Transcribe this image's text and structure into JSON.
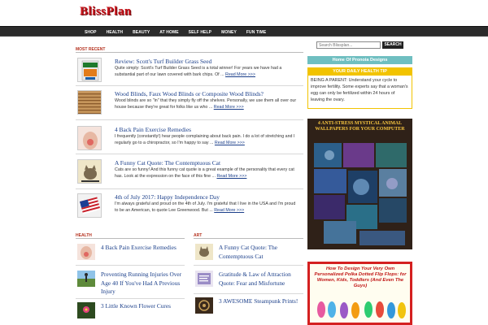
{
  "site": {
    "logo": "BlissPlan"
  },
  "nav": {
    "items": [
      "SHOP",
      "HEALTH",
      "BEAUTY",
      "AT HOME",
      "SELF HELP",
      "MONEY",
      "FUN TIME"
    ]
  },
  "most_recent": {
    "label": "MOST RECENT",
    "posts": [
      {
        "title": "Review: Scott's Turf Builder Grass Seed",
        "excerpt": "Quite simply: Scott's Turf Builder Grass Seed is a total winner! For years we have had a substantial part of our lawn covered with bark chips. Of ...",
        "read_more": "Read More >>>",
        "thumb_icon": "grass-seed-bag-icon"
      },
      {
        "title": "Wood Blinds, Faux Wood Blinds or Composite Wood Blinds?",
        "excerpt": "Wood blinds are so \"in\" that they simply fly off the shelves. Personally, we use them all over our house because they're great for folks like us who ...",
        "read_more": "Read More >>>",
        "thumb_icon": "wood-blinds-icon"
      },
      {
        "title": "4 Back Pain Exercise Remedies",
        "excerpt": "I frequently (constantly!) hear people complaining about back pain. I do a lot of stretching and I regularly go to a chiropractor, so I'm happy to say ...",
        "read_more": "Read More >>>",
        "thumb_icon": "back-pain-icon"
      },
      {
        "title": "A Funny Cat Quote: The Contemptuous Cat",
        "excerpt": "Cats are so funny! And this funny cat quote is a great example of the personality that every cat has. Look at the expression on the face of this fine ...",
        "read_more": "Read More >>>",
        "thumb_icon": "cat-icon"
      },
      {
        "title": "4th of July 2017: Happy Independence Day",
        "excerpt": "I'm always grateful and proud on the 4th of July. I'm grateful that I live in the USA and I'm proud to be an American, to quote Lee Greenwood. But ...",
        "read_more": "Read More >>>",
        "thumb_icon": "flag-icon"
      }
    ]
  },
  "health": {
    "label": "HEALTH",
    "posts": [
      {
        "title": "4 Back Pain Exercise Remedies",
        "thumb_icon": "back-pain-icon"
      },
      {
        "title": "Preventing Running Injuries Over Age 40 If You've Had A Previous Injury",
        "thumb_icon": "runner-icon"
      },
      {
        "title": "3 Little Known Flower Cures",
        "thumb_icon": "flower-icon"
      }
    ]
  },
  "art": {
    "label": "ART",
    "posts": [
      {
        "title": "A Funny Cat Quote: The Contemptuous Cat",
        "thumb_icon": "cat-icon"
      },
      {
        "title": "Gratitude & Law of Attraction Quote: Fear and Misfortune",
        "thumb_icon": "quote-card-icon"
      },
      {
        "title": "3 AWESOME Steampunk Prints!",
        "thumb_icon": "steampunk-icon"
      }
    ]
  },
  "sidebar": {
    "search_placeholder": "Search Blissplan...",
    "search_button": "SEARCH",
    "home_link": "Home Of Pronoia Designs",
    "health_tip": {
      "title": "YOUR DAILY HEALTH TIP",
      "text": "BEING A PARENT: Understand your cycle to improve fertility. Some experts say that a woman's egg can only be fertilized within 24 hours of leaving the ovary."
    },
    "ad1_title": "4 ANTI-STRESS MYSTICAL ANIMAL WALLPAPERS FOR YOUR COMPUTER",
    "ad2_title": "How To Design Your Very Own Personalized Polka Dotted Flip Flops: for Women, Kids, Toddlers (And Even The Guys)"
  },
  "colors": {
    "accent": "#c8141b",
    "nav_bg": "#2b2b2b",
    "link": "#1b3f8a",
    "teal": "#6fbfc1",
    "tip": "#f2c300"
  }
}
